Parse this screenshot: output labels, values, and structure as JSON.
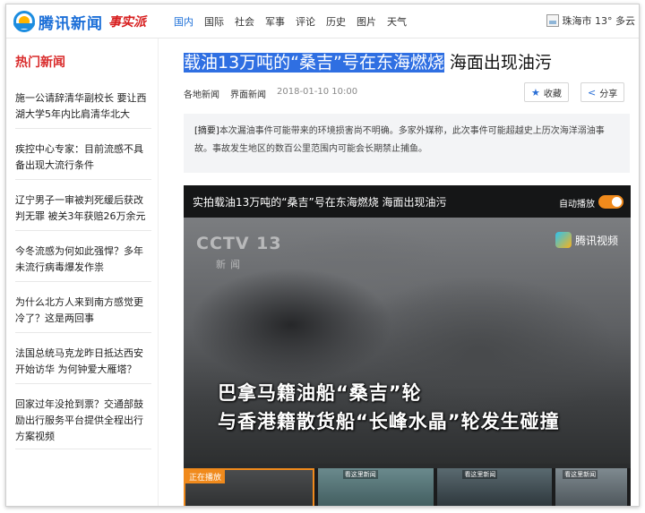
{
  "brand": {
    "logo_text": "腾讯新闻",
    "tag": "事实派"
  },
  "nav": {
    "items": [
      "国内",
      "国际",
      "社会",
      "军事",
      "评论",
      "历史",
      "图片",
      "天气"
    ],
    "active_index": 0
  },
  "weather": {
    "text": "珠海市 13° 多云"
  },
  "sidebar": {
    "title": "热门新闻",
    "items": [
      "施一公请辞清华副校长 要让西湖大学5年内比肩清华北大",
      "疾控中心专家：目前流感不具备出现大流行条件",
      "辽宁男子一审被判死缓后获改判无罪 被关3年获赔26万余元",
      "今冬流感为何如此强悍？多年未流行病毒爆发作祟",
      "为什么北方人来到南方感觉更冷了？这是两回事",
      "法国总统马克龙昨日抵达西安开始访华 为何钟爱大雁塔？",
      "回家过年没抢到票？交通部鼓励出行服务平台提供全程出行方案视频"
    ]
  },
  "article": {
    "headline_selected": "载油13万吨的“桑吉”号在东海燃烧",
    "headline_rest": " 海面出现油污",
    "source": "各地新闻",
    "source2": "界面新闻",
    "time": "2018-01-10 10:00",
    "collect_label": "收藏",
    "share_label": "分享",
    "summary_tag": "[摘要]",
    "summary": "本次漏油事件可能带来的环境损害尚不明确。多家外媒称，此次事件可能超越史上历次海洋溺油事故。事故发生地区的数百公里范围内可能会长期禁止捕鱼。"
  },
  "video": {
    "title": "实拍载油13万吨的“桑吉”号在东海燃烧 海面出现油污",
    "autoplay_label": "自动播放",
    "autoplay_on": true,
    "channel": "CCTV 13",
    "channel_sub": "新闻",
    "provider": "腾讯视频",
    "caption_line1": "巴拿马籍油船“桑吉”轮",
    "caption_line2": "与香港籍散货船“长峰水晶”轮发生碰撞",
    "now_playing_label": "正在播放",
    "thumb_tag": "看这里新闻"
  },
  "colors": {
    "accent": "#1c6fd8",
    "sidebar_title": "#d92b2b",
    "selection": "#2f6fe2",
    "toggle": "#f08a1c"
  }
}
